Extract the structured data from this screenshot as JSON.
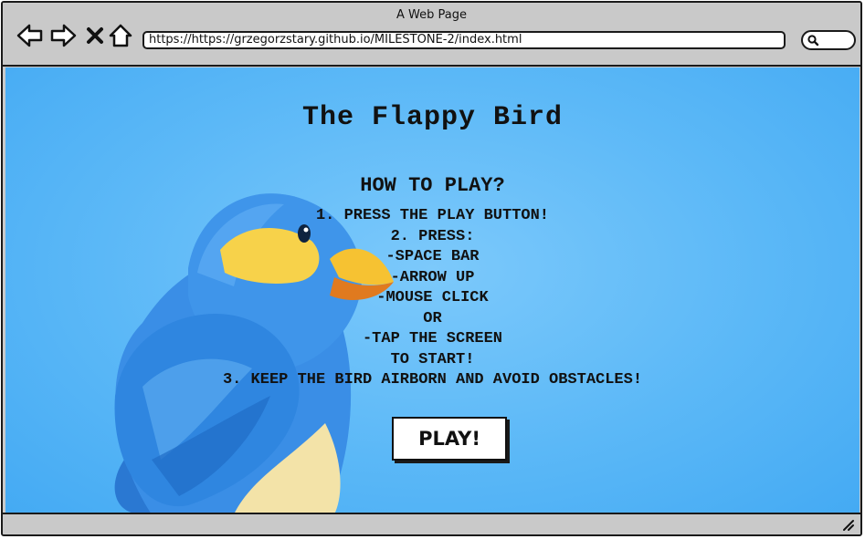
{
  "window": {
    "title": "A Web Page"
  },
  "toolbar": {
    "back_icon": "arrow-left-icon",
    "forward_icon": "arrow-right-icon",
    "stop_icon": "close-icon",
    "home_icon": "home-icon",
    "search_icon": "search-icon"
  },
  "address_bar": {
    "url": "https://https://grzegorzstary.github.io/MILESTONE-2/index.html"
  },
  "page": {
    "title": "The Flappy Bird",
    "how_to_play_heading": "HOW TO PLAY?",
    "instructions": [
      "1. PRESS THE PLAY BUTTON!",
      "2. PRESS:",
      "-SPACE BAR",
      "-ARROW UP",
      "-MOUSE CLICK",
      "OR",
      "-TAP THE SCREEN",
      "TO START!",
      "3. KEEP THE BIRD AIRBORN AND AVOID OBSTACLES!"
    ],
    "play_button_label": "PLAY!"
  },
  "colors": {
    "background_blue": "#5bb8f7",
    "bird_blue": "#2f86e0",
    "beak_yellow": "#f6c232",
    "chrome_gray": "#c9c9c9"
  }
}
